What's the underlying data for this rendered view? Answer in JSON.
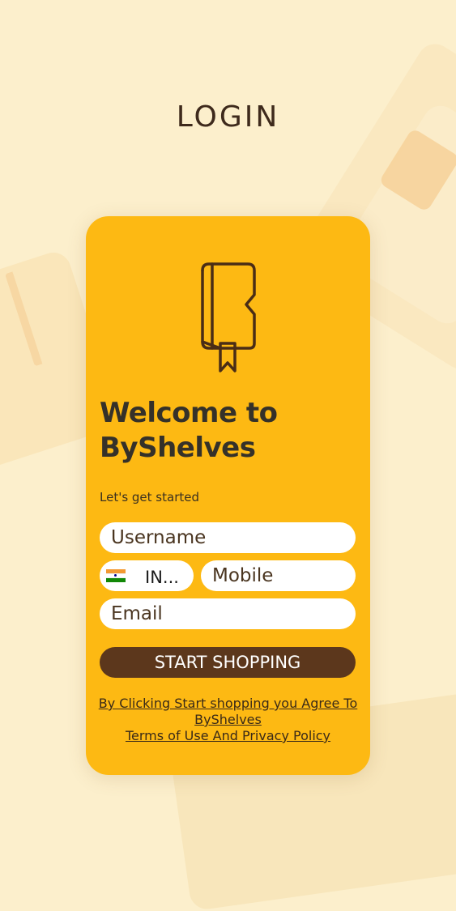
{
  "header": {
    "title": "LOGIN"
  },
  "card": {
    "logo_icon": "book-bookmark-icon",
    "welcome_line1": "Welcome to",
    "welcome_line2": "ByShelves",
    "subtitle": "Let's get started",
    "username": {
      "placeholder": "Username",
      "value": ""
    },
    "country": {
      "flag_icon": "india-flag-icon",
      "code": "IN..."
    },
    "mobile": {
      "placeholder": "Mobile",
      "value": ""
    },
    "email": {
      "placeholder": "Email",
      "value": ""
    },
    "start_button": "START SHOPPING",
    "terms_line1": "By Clicking Start shopping you Agree To",
    "terms_line2": "ByShelves",
    "terms_line3": "Terms of Use And Privacy Policy"
  },
  "colors": {
    "background": "#fcefcc",
    "card": "#fdb913",
    "button": "#5c371c",
    "text_dark": "#353129"
  }
}
